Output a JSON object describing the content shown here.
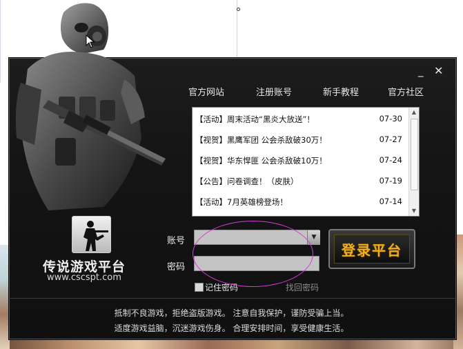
{
  "window": {
    "minimize_label": "_",
    "close_label": "✕"
  },
  "nav": {
    "official_site": "官方网站",
    "register": "注册账号",
    "tutorial": "新手教程",
    "community": "官方社区"
  },
  "news": [
    {
      "title": "【活动】周末活动“黑炎大放送”！",
      "date": "07-30"
    },
    {
      "title": "【视贺】黑鹰军团 公会杀敌破30万！",
      "date": "07-27"
    },
    {
      "title": "【视贺】华东悍匪 公会杀敌破10万！",
      "date": "07-24"
    },
    {
      "title": "【公告】问卷调查！（皮肤）",
      "date": "07-19"
    },
    {
      "title": "【活动】7月英雄榜登场！",
      "date": "07-14"
    }
  ],
  "logo": {
    "name": "传说游戏平台",
    "url": "www.cscspt.com"
  },
  "login": {
    "account_label": "账号",
    "password_label": "密码",
    "account_value": "",
    "password_value": "",
    "button_label": "登录平台",
    "remember_label": "记住密码",
    "find_password": "找回密码"
  },
  "footer": {
    "line1": "抵制不良游戏，拒绝盗版游戏。 注意自我保护，谨防受骗上当。",
    "line2": "适度游戏益脑，沉迷游戏伤身。 合理安排时间，享受健康生活。"
  },
  "icons": {
    "logo": "soldier-silhouette-icon",
    "dropdown": "triangle-down-icon",
    "scroll_up": "triangle-up-icon",
    "scroll_down": "triangle-down-icon"
  },
  "colors": {
    "window_bg": "#131313",
    "login_text": "#f0b21c",
    "annotation": "#d63bd6"
  }
}
